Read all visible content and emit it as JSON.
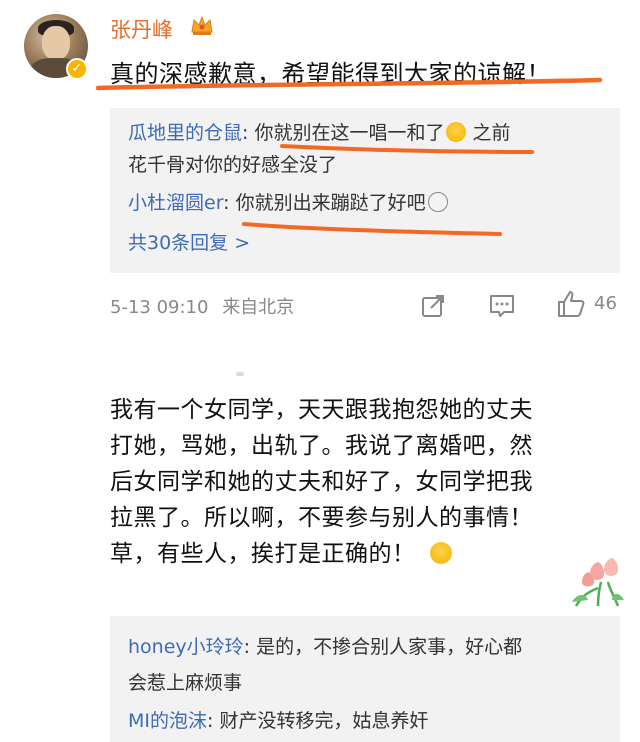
{
  "comment": {
    "username": "张丹峰",
    "text": "真的深感歉意，希望能得到大家的谅解！",
    "replies": [
      {
        "name": "瓜地里的仓鼠",
        "text_line1": ": 你就别在这一唱一和了",
        "emoji": "laughing-emoji",
        "text_tail": " 之前",
        "text_line2": "花千骨对你的好感全没了"
      },
      {
        "name": "小杜溜圆er",
        "text_line1": ": 你就别出来蹦跶了好吧",
        "emoji": "dizzy-face-emoji"
      }
    ],
    "more_replies": "共30条回复 >",
    "timestamp": "5-13 09:10",
    "source": "来自北京",
    "like_count": "46"
  },
  "comment2": {
    "lines": [
      "我有一个女同学，天天跟我抱怨她的丈夫",
      "打她，骂她，出轨了。我说了离婚吧，然",
      "后女同学和她的丈夫和好了，女同学把我",
      "拉黑了。所以啊，不要参与别人的事情！",
      "草，有些人，挨打是正确的！"
    ],
    "emoji": "shrug-emoji",
    "replies": [
      {
        "name": "honey小玲玲",
        "text_line1": ": 是的，不掺合别人家事，好心都",
        "text_line2": "会惹上麻烦事"
      },
      {
        "name": "MI的泡沫",
        "text_line1": ": 财产没转移完，姑息养奸"
      }
    ]
  },
  "colors": {
    "username": "#e86d2c",
    "link": "#3f6bb5",
    "underline": "#f26a21",
    "reply_bg": "#f2f2f2",
    "meta_text": "#888888"
  },
  "icons": [
    "verified-badge-icon",
    "crown-icon",
    "share-icon",
    "comment-icon",
    "like-icon",
    "tulip-sticker"
  ]
}
